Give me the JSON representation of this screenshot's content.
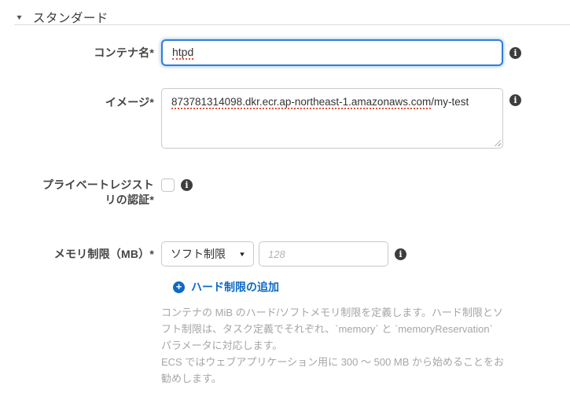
{
  "section": {
    "title": "スタンダード"
  },
  "form": {
    "container_name": {
      "label": "コンテナ名*",
      "value": "htpd"
    },
    "image": {
      "label": "イメージ*",
      "value": "873781314098.dkr.ecr.ap-northeast-1.amazonaws.com/my-test",
      "value_underlined": "873781314098.dkr.ecr.ap-northeast-1.amazonaws.com",
      "value_rest": "/my-test"
    },
    "private_registry_auth": {
      "label_line1": "プライベートレジスト",
      "label_line2": "リの認証*",
      "checked": false
    },
    "memory_limit": {
      "label": "メモリ制限（MB）*",
      "type_selected": "ソフト制限",
      "value_placeholder": "128"
    }
  },
  "actions": {
    "add_hard_limit": "ハード制限の追加"
  },
  "help_text": {
    "paragraph1": "コンテナの MiB のハード/ソフトメモリ制限を定義します。ハード制限とソフト制限は、タスク定義でそれぞれ、`memory` と `memoryReservation` パラメータに対応します。",
    "paragraph2": "ECS ではウェブアプリケーション用に 300 〜 500 MB から始めることをお勧めします。"
  },
  "icons": {
    "section_caret": "▼",
    "dropdown_caret": "▼",
    "info": "i",
    "plus": "+"
  },
  "colors": {
    "link_blue": "#0d69c7",
    "focus_border_blue": "#2f7ed8",
    "info_icon_bg": "#3d3d3d",
    "help_text_gray": "#a6a6a6",
    "spellcheck_red": "#e4503c"
  }
}
